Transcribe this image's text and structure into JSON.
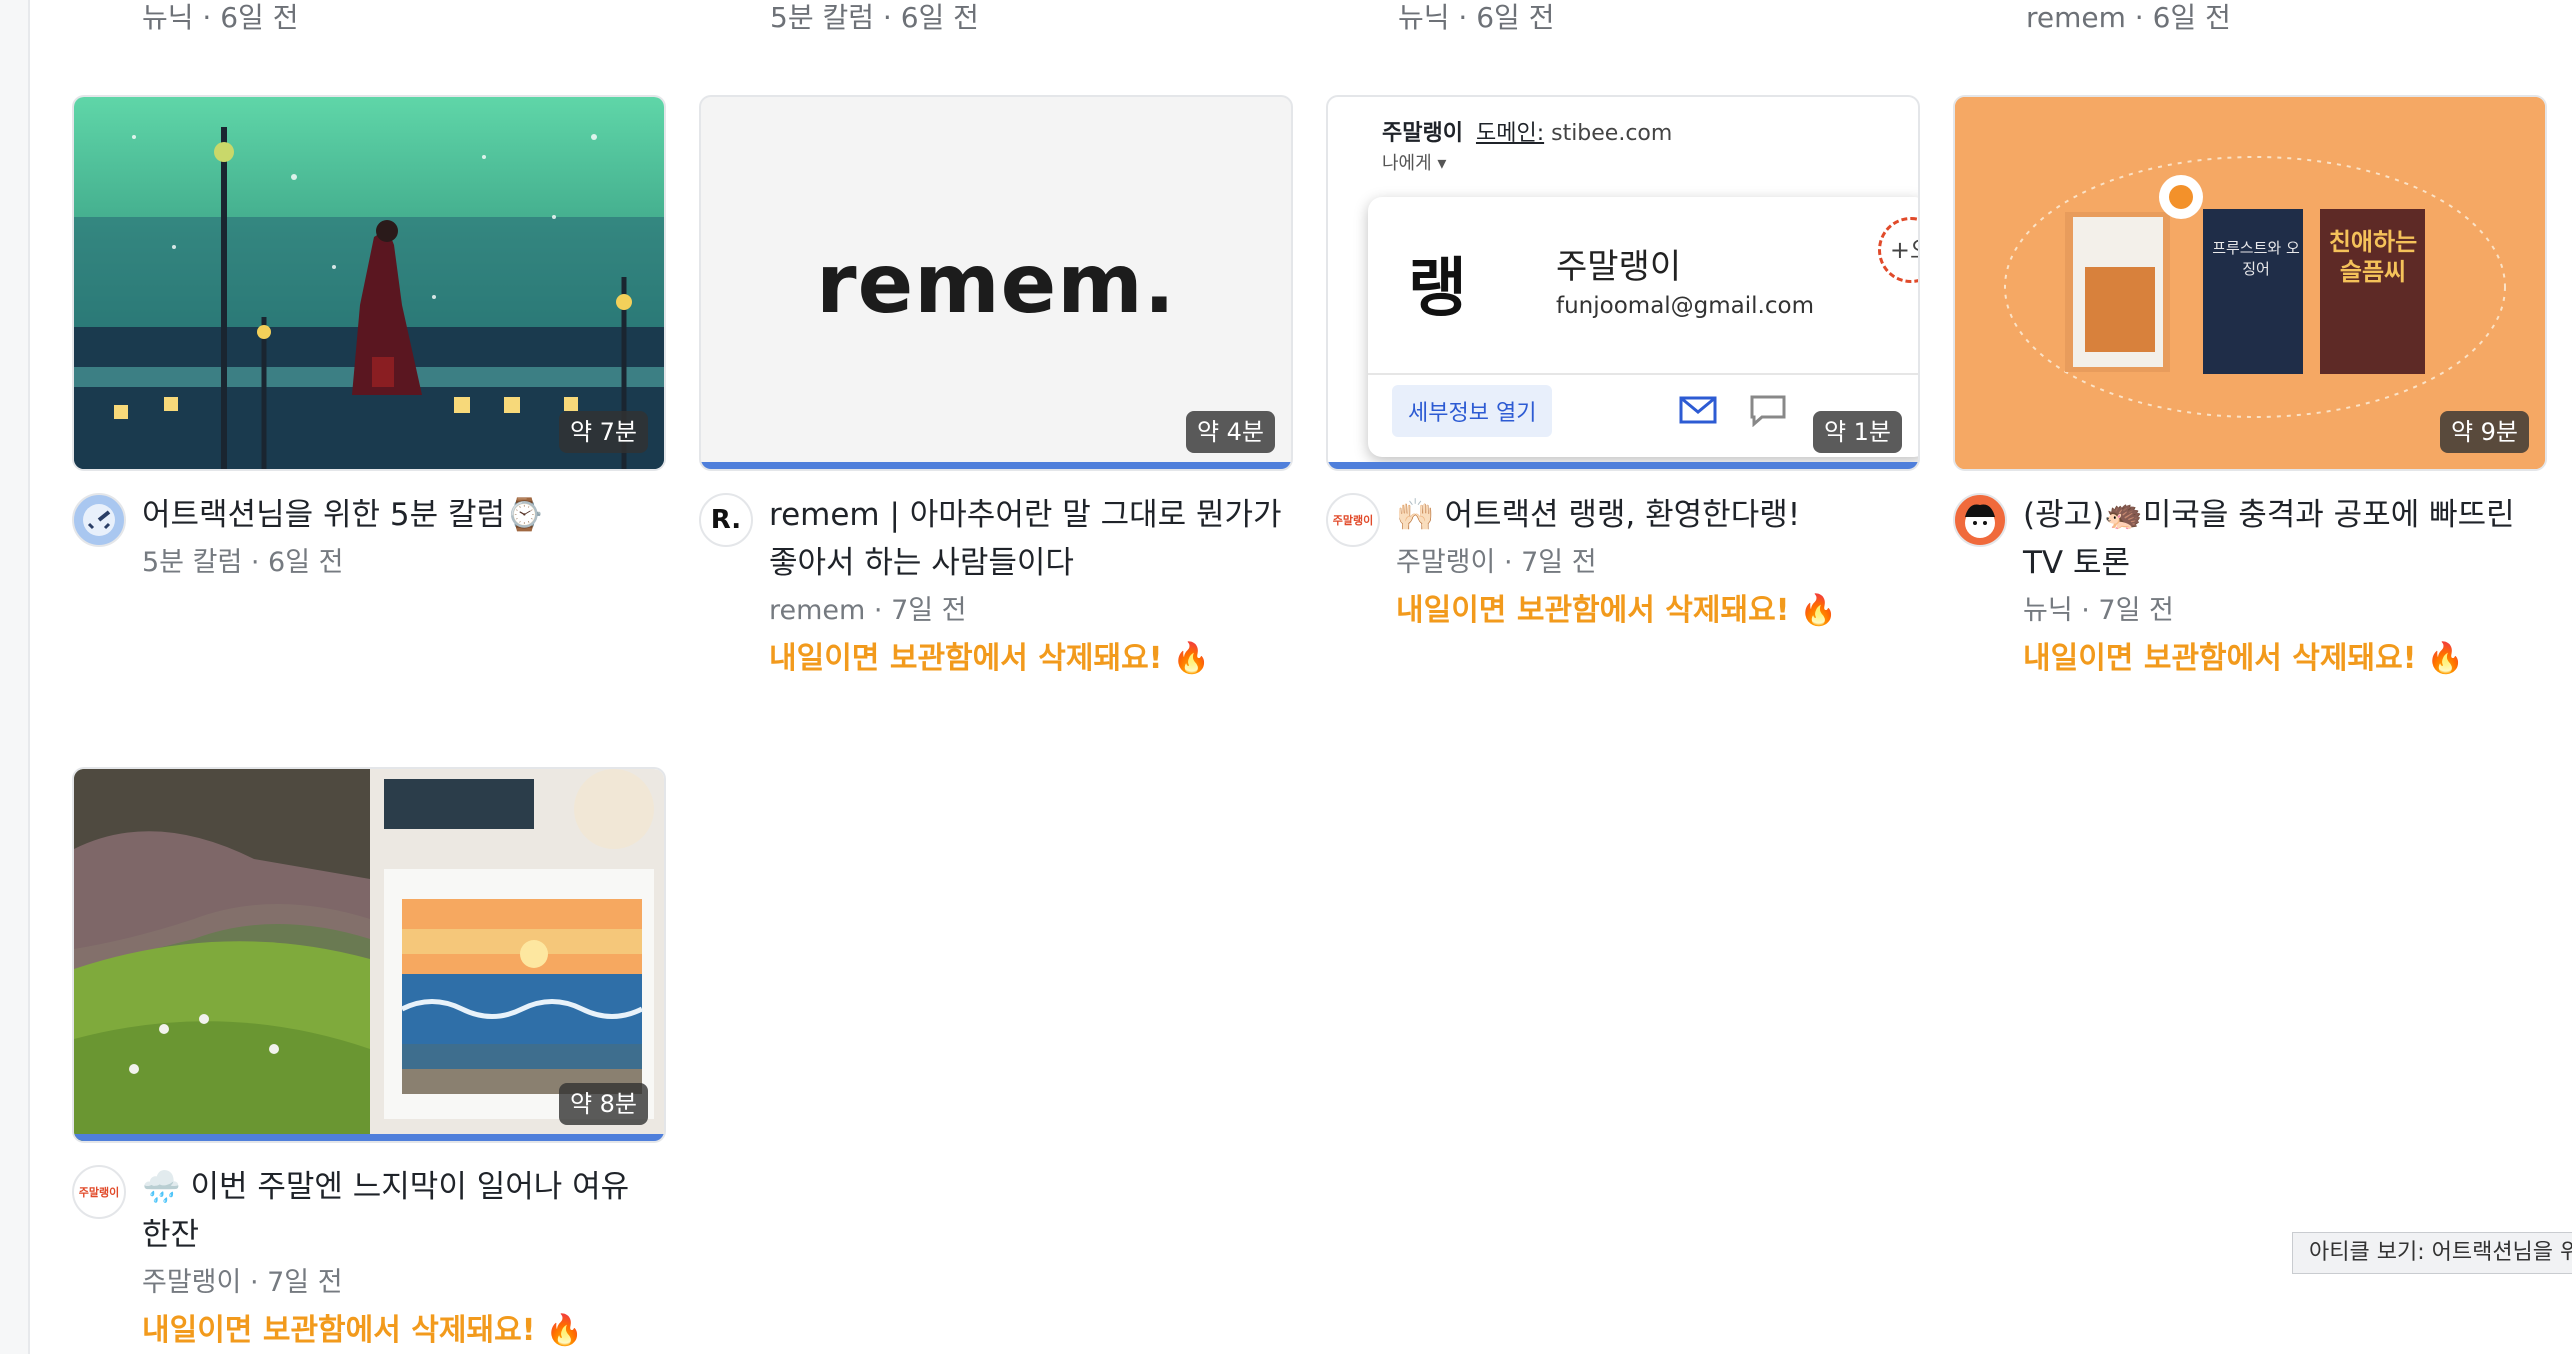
{
  "top_row": [
    {
      "meta": "뉴닉 · 6일 전"
    },
    {
      "meta": "5분 칼럼 · 6일 전"
    },
    {
      "meta": "뉴닉 · 6일 전"
    },
    {
      "meta": "remem · 6일 전"
    }
  ],
  "cards": [
    {
      "read_time": "약 7분",
      "title": "어트랙션님을 위한 5분 칼럼⌚",
      "meta": "5분 칼럼 · 6일 전",
      "warning": ""
    },
    {
      "read_time": "약 4분",
      "title": "remem | 아마추어란 말 그대로 뭔가가 좋아서 하는 사람들이다",
      "meta": "remem · 7일 전",
      "warning": "내일이면 보관함에서 삭제돼요! 🔥",
      "thumb_text": "remem.",
      "avatar_text": "R."
    },
    {
      "read_time": "약 1분",
      "title": "🙌🏻 어트랙션 랭랭, 환영한다랭!",
      "meta": "주말랭이 · 7일 전",
      "warning": "내일이면 보관함에서 삭제돼요! 🔥",
      "email": {
        "sender": "주말랭이",
        "domain_label": "도메인:",
        "domain": "stibee.com",
        "to": "나에게 ▾",
        "logo": "랭",
        "name": "주말랭이",
        "address": "funjoomal@gmail.com",
        "details_button": "세부정보 열기",
        "plus": "+오"
      },
      "avatar_text": "주말랭이"
    },
    {
      "read_time": "약 9분",
      "title": "(광고)🦔미국을 충격과 공포에 빠뜨린 TV 토론",
      "meta": "뉴닉 · 7일 전",
      "warning": "내일이면 보관함에서 삭제돼요! 🔥",
      "books": [
        "프루스트와 오징어",
        "친애하는 슬픔씨"
      ]
    },
    {
      "read_time": "약 8분",
      "title": "🌧️ 이번 주말엔 느지막이 일어나 여유 한잔",
      "meta": "주말랭이 · 7일 전",
      "warning": "내일이면 보관함에서 삭제돼요! 🔥",
      "avatar_text": "주말랭이"
    }
  ],
  "tooltip": "아티클 보기: 어트랙션님을 위한",
  "colors": {
    "accent": "#4f7fdb",
    "warning": "#f29a1c",
    "progress": "#4f7fdb"
  }
}
